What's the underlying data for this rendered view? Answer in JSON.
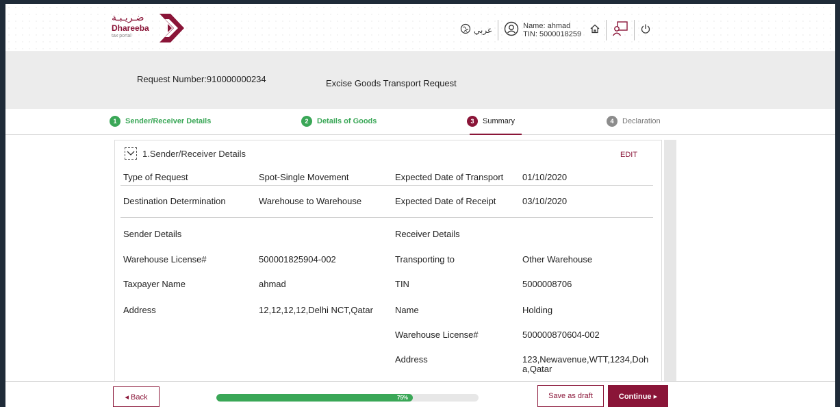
{
  "header": {
    "logo_arabic": "ضـريـبـة",
    "logo_english": "Dhareeba",
    "logo_tagline": "tax portal",
    "language_label": "عربي",
    "user_name_line": "Name: ahmad",
    "user_tin_line": "TIN: 5000018259",
    "icons": [
      "globe-icon",
      "user-circle-icon",
      "home-icon",
      "users-icon",
      "power-icon"
    ],
    "brand_color": "#8a1538"
  },
  "request": {
    "number": "Request Number:910000000234",
    "type": "Excise Goods Transport Request"
  },
  "steps": [
    {
      "num": "1",
      "label": "Sender/Receiver Details",
      "state": "done"
    },
    {
      "num": "2",
      "label": "Details of Goods",
      "state": "done"
    },
    {
      "num": "3",
      "label": "Summary",
      "state": "active"
    },
    {
      "num": "4",
      "label": "Declaration",
      "state": "todo"
    }
  ],
  "section": {
    "title": "1.Sender/Receiver Details",
    "edit": "EDIT",
    "type_of_request_label": "Type of Request",
    "type_of_request_value": "Spot-Single Movement",
    "expected_transport_label": "Expected Date of Transport",
    "expected_transport_value": "01/10/2020",
    "destination_label": "Destination Determination",
    "destination_value": "Warehouse to Warehouse",
    "expected_receipt_label": "Expected Date of Receipt",
    "expected_receipt_value": "03/10/2020",
    "sender": {
      "heading": "Sender Details",
      "warehouse_label": "Warehouse License#",
      "warehouse_value": "500001825904-002",
      "taxpayer_label": "Taxpayer Name",
      "taxpayer_value": "ahmad",
      "address_label": "Address",
      "address_value": "12,12,12,12,Delhi NCT,Qatar"
    },
    "receiver": {
      "heading": "Receiver Details",
      "transporting_label": "Transporting to",
      "transporting_value": "Other Warehouse",
      "tin_label": "TIN",
      "tin_value": "5000008706",
      "name_label": "Name",
      "name_value": "Holding",
      "warehouse_label": "Warehouse License#",
      "warehouse_value": "500000870604-002",
      "address_label": "Address",
      "address_value_line1": "123,Newavenue,WTT,1234,Doh",
      "address_value_line2": "a,Qatar"
    }
  },
  "footer": {
    "back": "◂  Back",
    "progress_label": "75%",
    "progress_fraction": 0.75,
    "save_draft": "Save as draft",
    "continue": "Continue  ▸"
  }
}
